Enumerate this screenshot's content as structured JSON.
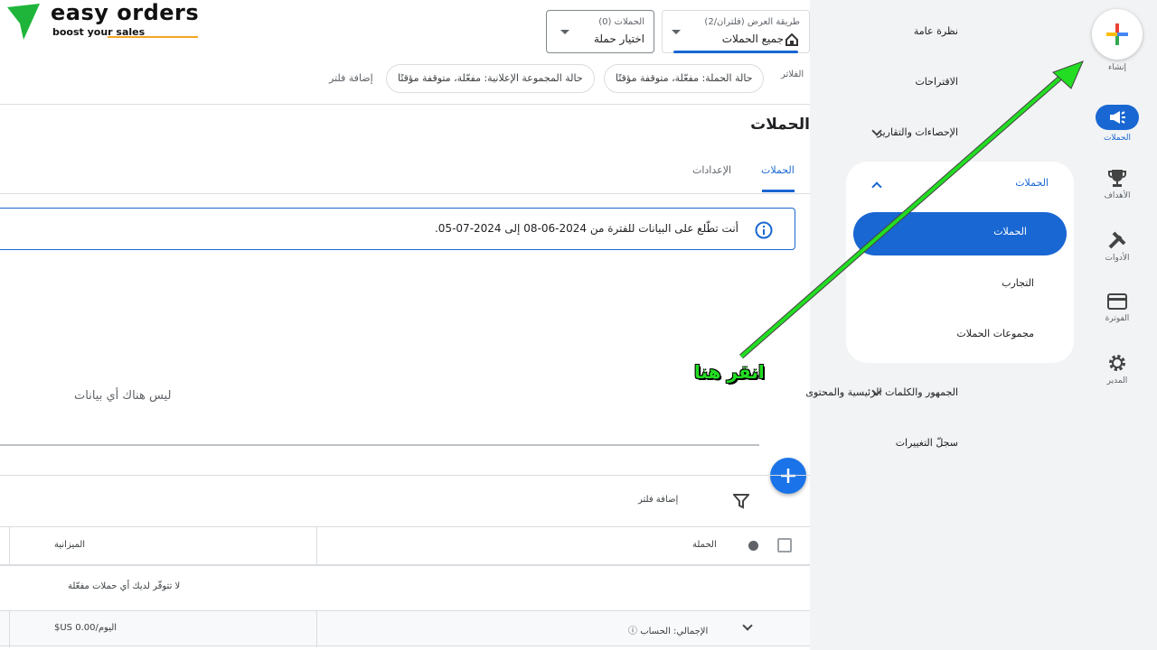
{
  "logo": {
    "name": "easy orders",
    "tagline": "boost your sales"
  },
  "header": {
    "view_selector": {
      "label": "طريقة العرض (فلتران/2)",
      "value": "جميع الحملات"
    },
    "campaign_selector": {
      "label": "الحملات (0)",
      "value": "اختيار حملة"
    }
  },
  "filters": {
    "label": "الفلاتر",
    "chips": [
      "حالة الحملة: مفعّلة، متوقفة مؤقتًا",
      "حالة المجموعة الإعلانية: مفعّلة، متوقفة مؤقتًا"
    ],
    "add": "إضافة فلتر"
  },
  "page_title": "الحملات",
  "tabs": [
    {
      "label": "الحملات",
      "active": true
    },
    {
      "label": "الإعدادات",
      "active": false
    }
  ],
  "info_banner": "أنت تطّلع على البيانات للفترة من 2024-06-08 إلى 2024-07-05.",
  "empty_chart": "ليس هناك أي بيانات",
  "table": {
    "add_filter": "إضافة فلتر",
    "columns": [
      "الحملة",
      "الميزانية"
    ],
    "empty_message": "لا تتوفّر لديك أي حملات مفعّلة",
    "total_row": {
      "label": "الإجمالي: الحساب",
      "budget": "$US 0.00/اليوم"
    }
  },
  "nav": {
    "items": [
      "نظرة عامة",
      "الاقتراحات",
      "الإحصاءات والتقارير"
    ],
    "group": {
      "title": "الحملات",
      "items": [
        "الحملات",
        "التجارب",
        "مجموعات الحملات"
      ],
      "active": 0
    },
    "after": [
      "الجمهور والكلمات الرئيسية والمحتوى",
      "سجلّ التغييرات"
    ]
  },
  "rail": [
    {
      "label": "إنشاء",
      "icon": "plus-icon"
    },
    {
      "label": "الحملات",
      "icon": "megaphone-icon",
      "active": true
    },
    {
      "label": "الأهداف",
      "icon": "trophy-icon"
    },
    {
      "label": "الأدوات",
      "icon": "tools-icon"
    },
    {
      "label": "الفوترة",
      "icon": "credit-card-icon"
    },
    {
      "label": "المدير",
      "icon": "gear-icon"
    }
  ],
  "annotation": "انقر هنا",
  "colors": {
    "accent": "#1967d2",
    "arrow": "#22dd22",
    "nav_bg": "#f1f3f4"
  }
}
